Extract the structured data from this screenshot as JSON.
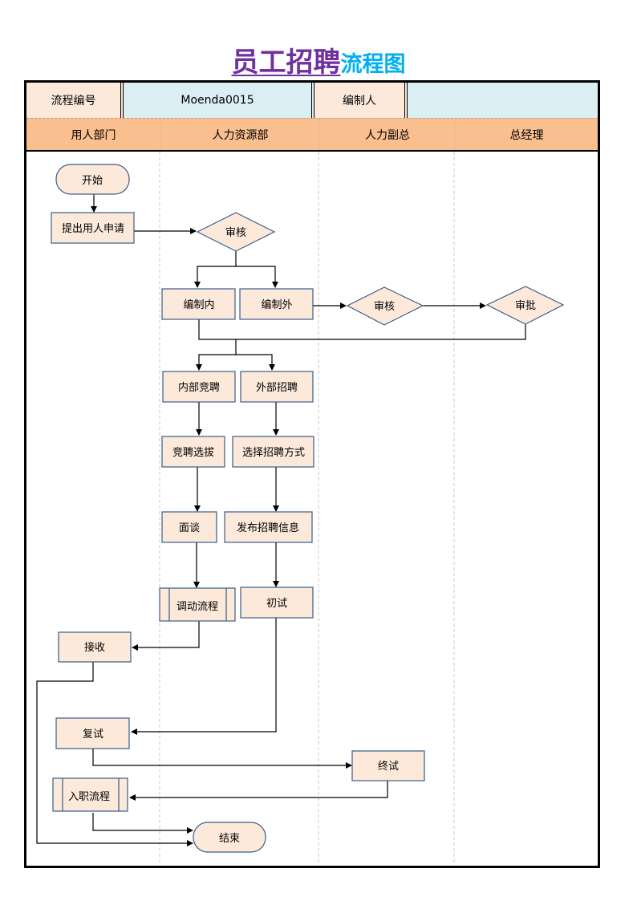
{
  "title": {
    "part1": "员工招聘",
    "part2": "流程图",
    "part1_color": "#7030A0",
    "part2_color": "#00B0F0"
  },
  "header": {
    "process_no_label": "流程编号",
    "process_no_value": "Moenda0015",
    "author_label": "编制人",
    "author_value": ""
  },
  "lanes": [
    "用人部门",
    "人力资源部",
    "人力副总",
    "总经理"
  ],
  "colors": {
    "node_fill": "#FCE9DA",
    "node_stroke": "#385D8A",
    "lane_header": "#FABF8F",
    "value_cell": "#DAEEF3"
  },
  "nodes": {
    "start": "开始",
    "apply": "提出用人申请",
    "review1": "审核",
    "in_quota": "编制内",
    "out_quota": "编制外",
    "review2": "审核",
    "approve": "审批",
    "internal": "内部竞聘",
    "external": "外部招聘",
    "select": "竞聘选拔",
    "method": "选择招聘方式",
    "interview": "面谈",
    "publish": "发布招聘信息",
    "transfer": "调动流程",
    "first_test": "初试",
    "receive": "接收",
    "second_test": "复试",
    "final_test": "终试",
    "onboard": "入职流程",
    "end": "结束"
  }
}
